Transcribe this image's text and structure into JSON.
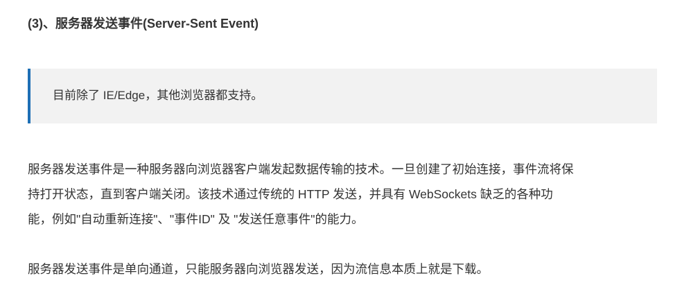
{
  "article": {
    "heading": "(3)、服务器发送事件(Server-Sent Event)",
    "note": "目前除了 IE/Edge，其他浏览器都支持。",
    "paragraph1_lines": [
      "服务器发送事件是一种服务器向浏览器客户端发起数据传输的技术。一旦创建了初始连接，事件流将保",
      "持打开状态，直到客户端关闭。该技术通过传统的 HTTP 发送，并具有 WebSockets 缺乏的各种功",
      "能，例如\"自动重新连接\"、\"事件ID\" 及 \"发送任意事件\"的能力。"
    ],
    "paragraph2": "服务器发送事件是单向通道，只能服务器向浏览器发送，因为流信息本质上就是下载。"
  },
  "colors": {
    "text": "#333333",
    "note_background": "#f2f2f2",
    "note_border": "#1e6fb5"
  }
}
